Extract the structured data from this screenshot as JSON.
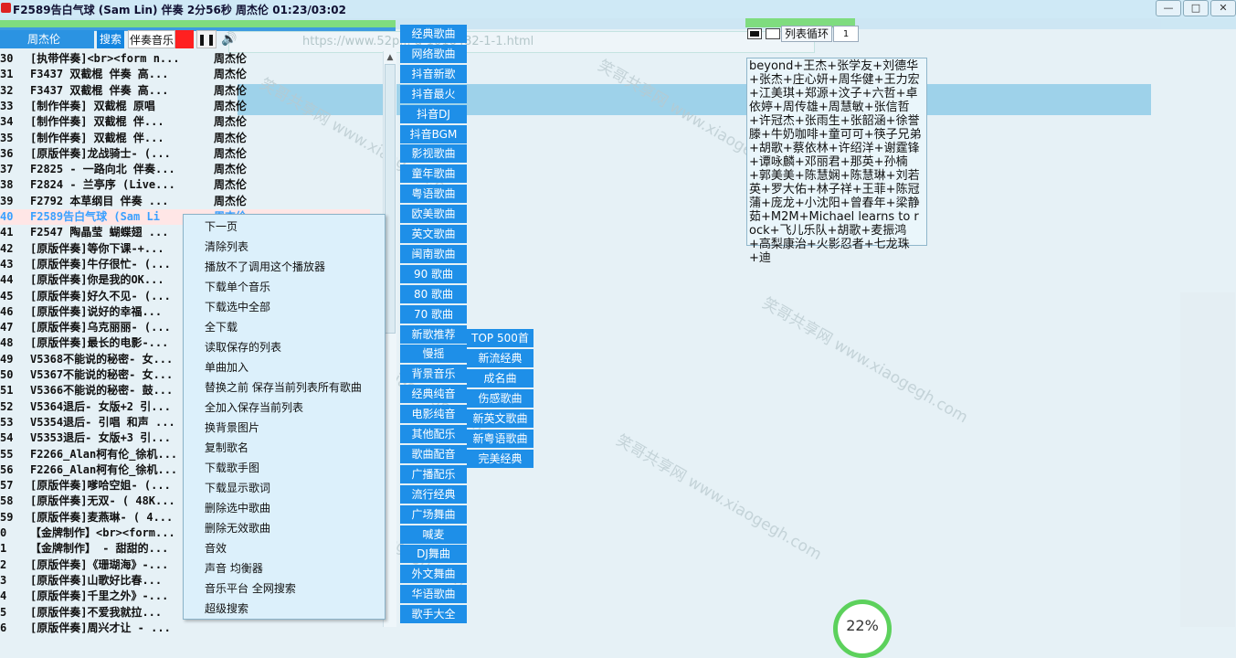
{
  "window": {
    "title": "F2589告白气球 (Sam Lin)  伴奏 2分56秒   周杰伦  01:23/03:02",
    "controls": [
      "—",
      "□",
      "✕"
    ]
  },
  "background": {
    "address": "https://www.52p... d-1016482-1-1.html",
    "watermark": "笑哥共享网 www.xiaogegh.com"
  },
  "search": {
    "value": "周杰伦",
    "search_label": "搜索",
    "accompaniment_label": "伴奏音乐",
    "pause_icon": "pause-icon",
    "volume_icon": "volume-icon"
  },
  "playlist": {
    "active_index": 10,
    "rows": [
      {
        "num": "30",
        "title": "[执带伴奏]<br><form n...",
        "artist": "周杰伦"
      },
      {
        "num": "31",
        "title": "F3437 双截棍 伴奏 高...",
        "artist": "周杰伦"
      },
      {
        "num": "32",
        "title": "F3437 双截棍 伴奏 高...",
        "artist": "周杰伦"
      },
      {
        "num": "33",
        "title": "[制作伴奏] 双截棍 原唱",
        "artist": "周杰伦"
      },
      {
        "num": "34",
        "title": "[制作伴奏] 双截棍 伴...",
        "artist": "周杰伦"
      },
      {
        "num": "35",
        "title": "[制作伴奏] 双截棍 伴...",
        "artist": "周杰伦"
      },
      {
        "num": "36",
        "title": "[原版伴奏]龙战骑士- (...",
        "artist": "周杰伦"
      },
      {
        "num": "37",
        "title": "F2825 - 一路向北 伴奏...",
        "artist": "周杰伦"
      },
      {
        "num": "38",
        "title": "F2824 - 兰亭序 (Live...",
        "artist": "周杰伦"
      },
      {
        "num": "39",
        "title": "F2792 本草纲目 伴奏 ...",
        "artist": "周杰伦"
      },
      {
        "num": "40",
        "title": "F2589告白气球 (Sam Li",
        "artist": "周杰伦"
      },
      {
        "num": "41",
        "title": "F2547 陶晶莹 蝴蝶翅 ...",
        "artist": ""
      },
      {
        "num": "42",
        "title": "[原版伴奏]等你下课-+...",
        "artist": ""
      },
      {
        "num": "43",
        "title": "[原版伴奏]牛仔很忙- (...",
        "artist": ""
      },
      {
        "num": "44",
        "title": "[原版伴奏]你是我的OK...",
        "artist": ""
      },
      {
        "num": "45",
        "title": "[原版伴奏]好久不见- (...",
        "artist": ""
      },
      {
        "num": "46",
        "title": "[原版伴奏]说好的幸福...",
        "artist": ""
      },
      {
        "num": "47",
        "title": "[原版伴奏]乌克丽丽- (...",
        "artist": ""
      },
      {
        "num": "48",
        "title": "[原版伴奏]最长的电影-...",
        "artist": ""
      },
      {
        "num": "49",
        "title": "V5368不能说的秘密- 女...",
        "artist": ""
      },
      {
        "num": "50",
        "title": "V5367不能说的秘密- 女...",
        "artist": ""
      },
      {
        "num": "51",
        "title": "V5366不能说的秘密- 鼓...",
        "artist": ""
      },
      {
        "num": "52",
        "title": "V5364退后- 女版+2 引...",
        "artist": ""
      },
      {
        "num": "53",
        "title": "V5354退后- 引唱 和声 ...",
        "artist": ""
      },
      {
        "num": "54",
        "title": "V5353退后- 女版+3 引...",
        "artist": ""
      },
      {
        "num": "55",
        "title": "F2266_Alan柯有伦_徐机...",
        "artist": ""
      },
      {
        "num": "56",
        "title": "F2266_Alan柯有伦_徐机...",
        "artist": ""
      },
      {
        "num": "57",
        "title": "[原版伴奏]嗲哈空姐- (...",
        "artist": ""
      },
      {
        "num": "58",
        "title": "[原版伴奏]无双- ( 48K...",
        "artist": ""
      },
      {
        "num": "59",
        "title": "[原版伴奏]麦燕琳- ( 4...",
        "artist": ""
      },
      {
        "num": "0",
        "title": "【金牌制作】<br><form...",
        "artist": ""
      },
      {
        "num": "1",
        "title": "【金牌制作】 - 甜甜的...",
        "artist": ""
      },
      {
        "num": "2",
        "title": "[原版伴奏]《珊瑚海》-...",
        "artist": ""
      },
      {
        "num": "3",
        "title": "[原版伴奏]山歌好比春...",
        "artist": ""
      },
      {
        "num": "4",
        "title": "[原版伴奏]千里之外》-...",
        "artist": ""
      },
      {
        "num": "5",
        "title": "[原版伴奏]不爱我就拉...",
        "artist": ""
      },
      {
        "num": "6",
        "title": "[原版伴奏]周兴才让 - ...",
        "artist": ""
      }
    ]
  },
  "context_menu": {
    "items": [
      "下一页",
      "清除列表",
      "播放不了调用这个播放器",
      "下载单个音乐",
      "下载选中全部",
      "全下载",
      "读取保存的列表",
      "单曲加入",
      "替换之前  保存当前列表所有歌曲",
      "全加入保存当前列表",
      "换背景图片",
      "复制歌名",
      "下载歌手图",
      "下载显示歌词",
      "删除选中歌曲",
      "删除无效歌曲",
      "音效",
      "声音 均衡器",
      "音乐平台 全网搜索",
      "超级搜索"
    ]
  },
  "categories_left": [
    "经典歌曲",
    "网络歌曲",
    "抖音新歌",
    "抖音最火",
    "抖音DJ",
    "抖音BGM",
    "影视歌曲",
    "童年歌曲",
    "粤语歌曲",
    "欧美歌曲",
    "英文歌曲",
    "闽南歌曲",
    "90 歌曲",
    "80 歌曲",
    "70 歌曲",
    "新歌推荐",
    "慢摇",
    "背景音乐",
    "经典纯音",
    "电影纯音",
    "其他配乐",
    "歌曲配音",
    "广播配乐",
    "流行经典",
    "广场舞曲",
    "喊麦",
    "DJ舞曲",
    "外文舞曲",
    "华语歌曲",
    "歌手大全"
  ],
  "categories_right": [
    "TOP 500首",
    "新流经典",
    "成名曲",
    "伤感歌曲",
    "新英文歌曲",
    "新粤语歌曲",
    "完美经典"
  ],
  "play_mode": {
    "mode": "列表循环",
    "count": "1"
  },
  "artists_text": "beyond+王杰+张学友+刘德华+张杰+庄心妍+周华健+王力宏+江美琪+郑源+汶子+六哲+卓依婷+周传雄+周慧敏+张信哲+许冠杰+张雨生+张韶涵+徐誉滕+牛奶咖啡+童可可+筷子兄弟+胡歌+蔡依林+许绍洋+谢霆锋+谭咏麟+邓丽君+那英+孙楠+郭美美+陈慧娴+陈慧琳+刘若英+罗大佑+林子祥+王菲+陈冠蒲+庞龙+小沈阳+曾春年+梁静茹+M2M+Michael learns to rock+飞儿乐队+胡歌+麦振鸿+高梨康治+火影忍者+七龙珠+迪",
  "progress": {
    "label": "22%",
    "value": 22
  }
}
